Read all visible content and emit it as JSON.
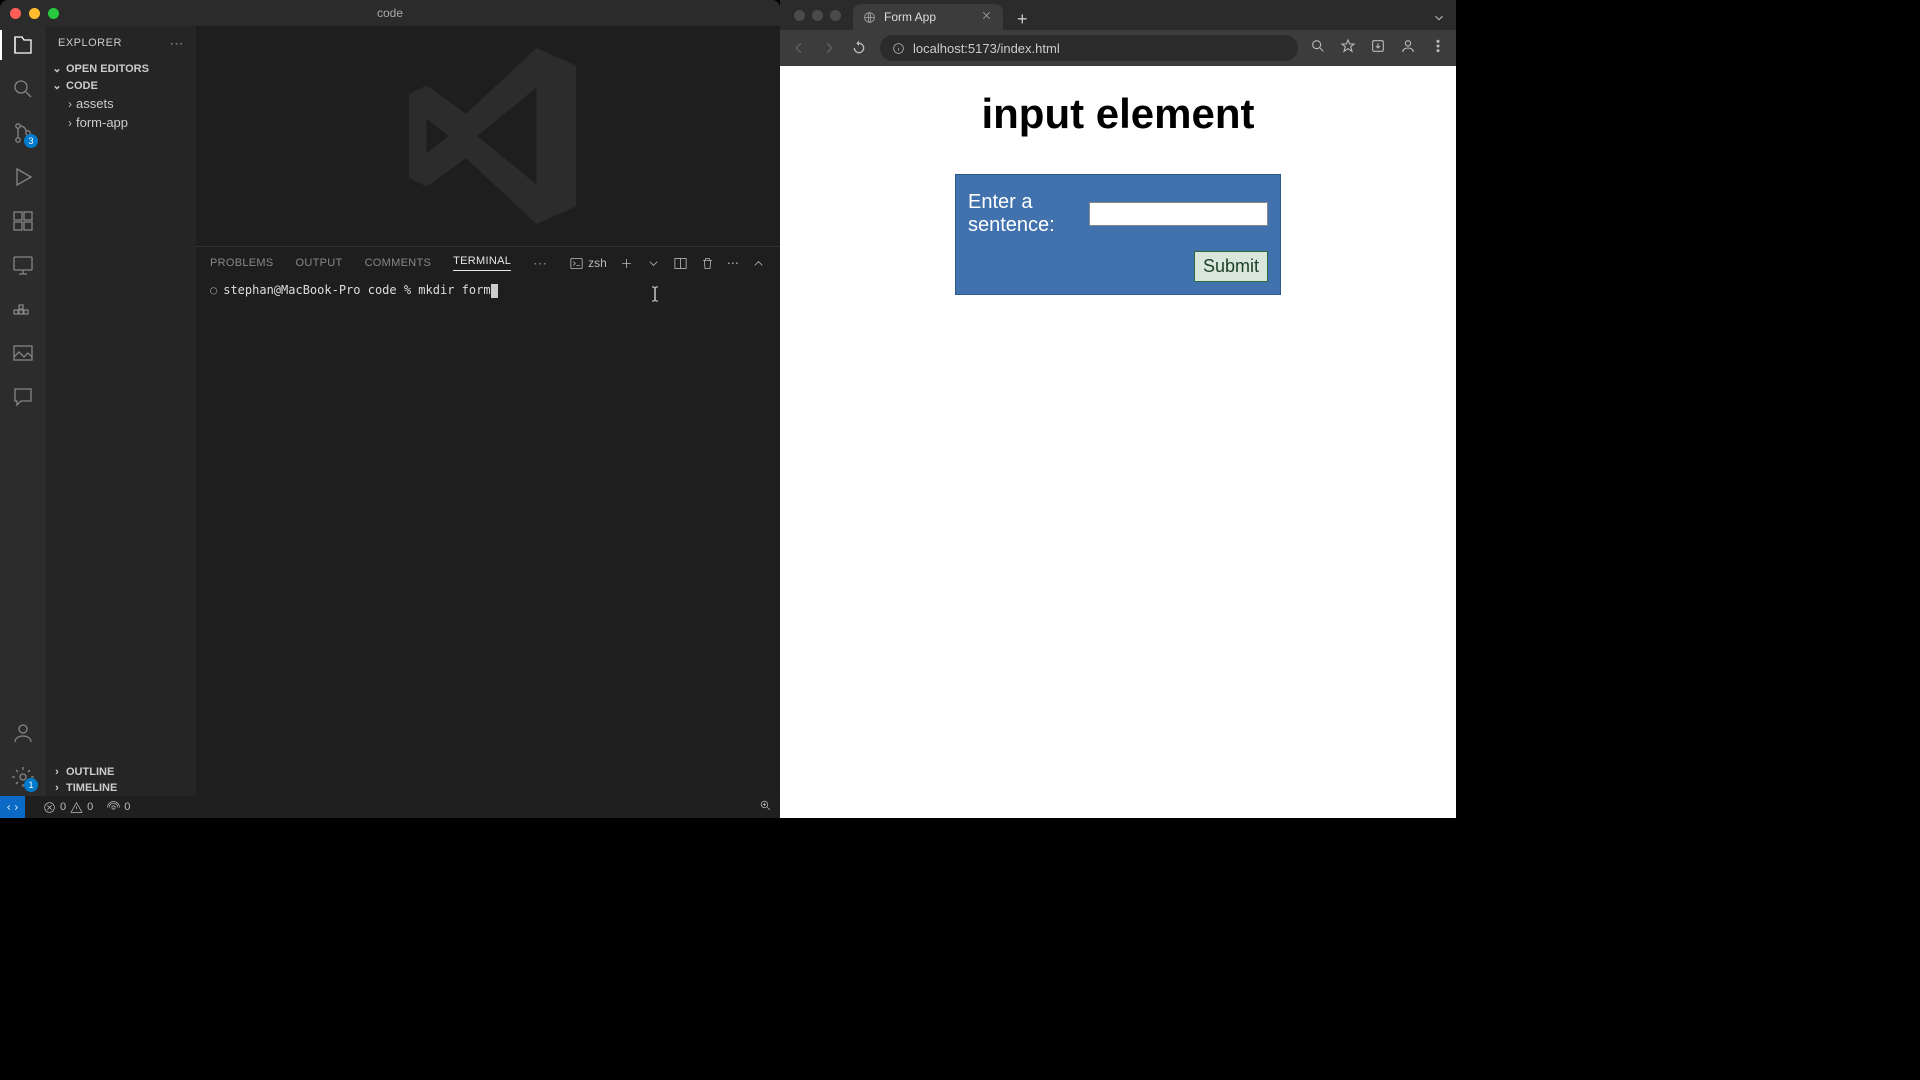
{
  "vscode": {
    "title": "code",
    "explorer": {
      "title": "EXPLORER",
      "openEditors": "OPEN EDITORS",
      "workspace": "CODE",
      "tree": [
        {
          "label": "assets"
        },
        {
          "label": "form-app"
        }
      ],
      "outline": "OUTLINE",
      "timeline": "TIMELINE"
    },
    "activity": {
      "scm_badge": "3",
      "settings_badge": "1"
    },
    "panel": {
      "tabs": {
        "problems": "PROBLEMS",
        "output": "OUTPUT",
        "comments": "COMMENTS",
        "terminal": "TERMINAL"
      },
      "shell": "zsh",
      "line": "stephan@MacBook-Pro code % mkdir form"
    },
    "status": {
      "err": "0",
      "warn": "0",
      "ports": "0"
    }
  },
  "browser": {
    "tab": "Form App",
    "url": "localhost:5173/index.html",
    "page": {
      "heading": "input element",
      "label": "Enter a sentence:",
      "submit": "Submit"
    }
  }
}
